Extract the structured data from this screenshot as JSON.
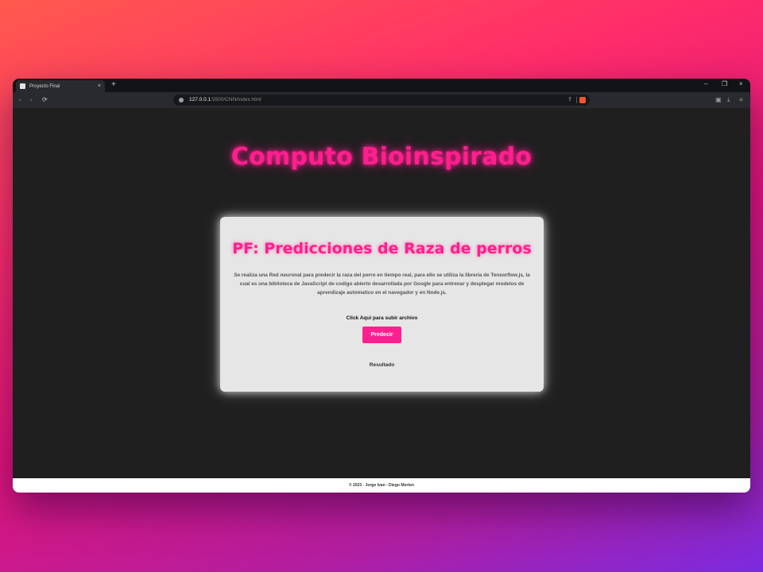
{
  "browser": {
    "tab_title": "Proyecto Final",
    "tab_close": "×",
    "new_tab": "+",
    "url_host": "127.0.0.1",
    "url_path": ":5500/CNN/index.html",
    "window_controls": {
      "minimize": "–",
      "restore": "❐",
      "close": "×"
    },
    "nav": {
      "back": "‹",
      "forward": "›",
      "reload": "⟳"
    },
    "icons": {
      "favicon": "shield-icon",
      "share": "share-icon",
      "brave": "brave-lion-icon",
      "menu": "menu-icon"
    }
  },
  "page": {
    "title": "Computo Bioinspirado",
    "card": {
      "title": "PF: Predicciones de Raza de perros",
      "description": "Se realiza una Red neuronal para predecir la raza del perro en tiempo real, para ello se utiliza la libreria de Tensorflow.js, la cual es una biblioteca de JavaScript de codigo abierto desarrollada por Google para entrenar y desplegar modelos de aprendizaje automatico en el navegador y en Node.js.",
      "upload_label": "Click Aqui para subir archivo",
      "predict_button": "Predecir",
      "result_label": "Resultado"
    },
    "footer": "© 2023 - Jorge Ivan - Diego Morten"
  },
  "colors": {
    "accent": "#ff1f8e",
    "page_bg": "#1f1f20",
    "card_bg": "#e6e6e6"
  }
}
